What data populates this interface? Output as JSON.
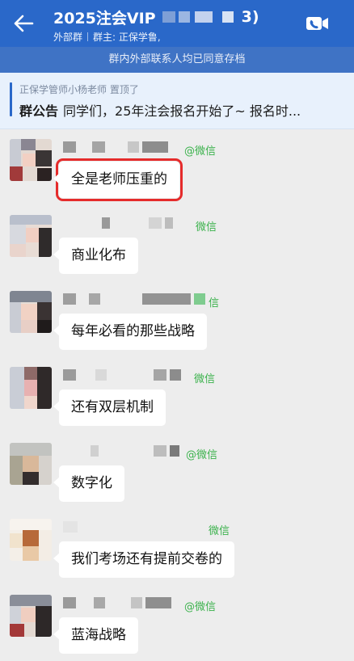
{
  "header": {
    "title": "2025注会VIP",
    "title_tail": "3)",
    "subtitle_left": "外部群",
    "subtitle_right": "群主: 正保学鲁,"
  },
  "notice_bar": "群内外部联系人均已同意存档",
  "announcement": {
    "meta": "正保学管师小杨老师 置顶了",
    "label": "群公告",
    "text": "同学们，25年注会报名开始了~ 报名时..."
  },
  "messages": [
    {
      "wechat": "@微信",
      "text": "全是老师压重的",
      "highlighted": true
    },
    {
      "wechat": "微信",
      "text": "商业化布",
      "highlighted": false
    },
    {
      "wechat": "信",
      "text": "每年必看的那些战略",
      "highlighted": false
    },
    {
      "wechat": "微信",
      "text": "还有双层机制",
      "highlighted": false
    },
    {
      "wechat": "@微信",
      "text": "数字化",
      "highlighted": false
    },
    {
      "wechat": "微信",
      "text": "我们考场还有提前交卷的",
      "highlighted": false
    },
    {
      "wechat": "@微信",
      "text": "蓝海战略",
      "highlighted": false
    }
  ],
  "icons": {
    "back": "back-arrow-icon",
    "video": "video-call-icon"
  },
  "colors": {
    "header_bg": "#2a68c9",
    "notice_bg": "#3f73c5",
    "announce_bg": "#e8f1fc",
    "chat_bg": "#ededed",
    "wechat_green": "#3bb24c",
    "highlight_red": "#e52b2b"
  }
}
